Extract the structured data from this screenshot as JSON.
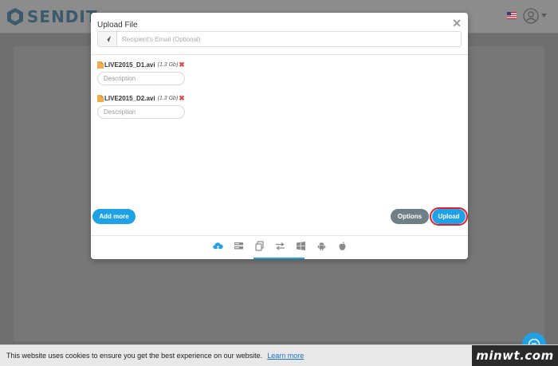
{
  "header": {
    "logo_text": "SENDIT",
    "flag_icon": "us-flag-icon",
    "user_icon": "user-account-icon"
  },
  "modal": {
    "title": "Upload File",
    "close_label": "✕",
    "email": {
      "placeholder": "Recipient's Email (Optional)",
      "icon": "send-plane-icon"
    },
    "files": [
      {
        "name": "LIVE2015_D1.avi",
        "size": "(1.3 Gb)",
        "description_placeholder": "Description"
      },
      {
        "name": "LIVE2015_D2.avi",
        "size": "(1.3 Gb)",
        "description_placeholder": "Description"
      }
    ],
    "buttons": {
      "add_more": "Add more",
      "options": "Options",
      "upload": "Upload"
    },
    "tabs": [
      {
        "icon": "cloud-upload-icon",
        "active": true
      },
      {
        "icon": "server-icon"
      },
      {
        "icon": "copy-icon"
      },
      {
        "icon": "transfer-arrows-icon"
      },
      {
        "icon": "windows-icon"
      },
      {
        "icon": "android-icon"
      },
      {
        "icon": "apple-icon"
      }
    ]
  },
  "cookie_bar": {
    "text": "This website uses cookies to ensure you get the best experience on our website.",
    "link": "Learn more"
  },
  "watermark": "minwt.com",
  "colors": {
    "accent": "#1ea1e6",
    "options_button": "#6f7f86",
    "highlight_ring": "#e0202a",
    "remove_x": "#d9534f",
    "file_icon": "#f0ad4e"
  }
}
